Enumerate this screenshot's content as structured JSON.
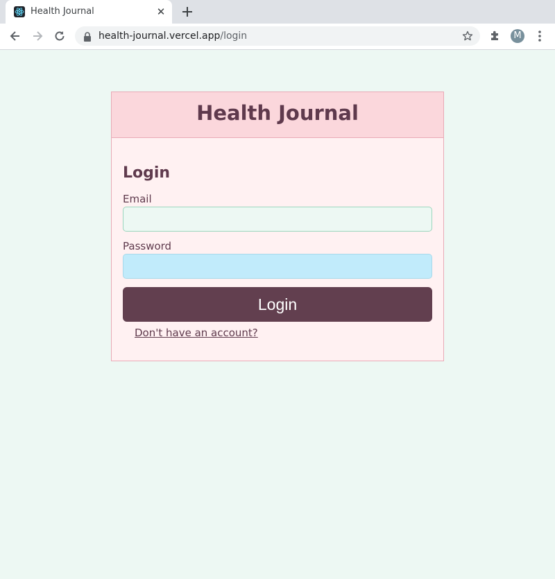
{
  "browser": {
    "tab_title": "Health Journal",
    "url_host": "health-journal.vercel.app",
    "url_path": "/login",
    "profile_initial": "M",
    "icons": {
      "favicon": "react-favicon",
      "close_tab": "close-icon",
      "new_tab": "plus-icon",
      "back": "back-arrow-icon",
      "forward": "forward-arrow-icon",
      "reload": "reload-icon",
      "lock": "lock-icon",
      "bookmark": "star-icon",
      "extensions": "puzzle-icon",
      "menu": "kebab-menu-icon"
    }
  },
  "page": {
    "app_title": "Health Journal",
    "form_heading": "Login",
    "email_label": "Email",
    "email_value": "",
    "password_label": "Password",
    "password_value": "",
    "login_button": "Login",
    "signup_link": "Don't have an account?"
  },
  "colors": {
    "page_background": "#edf8f3",
    "header_background": "#fbd7dc",
    "card_background": "#fff1f2",
    "primary_text": "#5f3a4d",
    "button_background": "#623f4f",
    "password_field_background": "#c1ebfb"
  }
}
